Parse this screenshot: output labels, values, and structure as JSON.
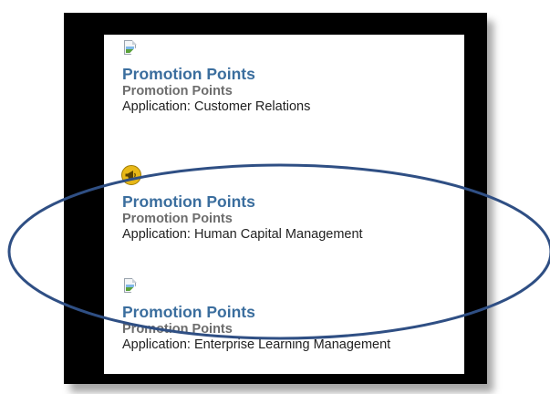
{
  "results": [
    {
      "icon": "broken-image-icon",
      "title": "Promotion Points",
      "subtitle": "Promotion Points",
      "application": "Application: Customer Relations"
    },
    {
      "icon": "megaphone-icon",
      "title": "Promotion Points",
      "subtitle": "Promotion Points",
      "application": "Application: Human Capital Management"
    },
    {
      "icon": "broken-image-icon",
      "title": "Promotion Points",
      "subtitle": "Promotion Points",
      "application": "Application: Enterprise Learning Management"
    }
  ],
  "colors": {
    "title": "#3b6e9e",
    "subtitle": "#6d6d6d",
    "application": "#222222",
    "frame": "#000000",
    "highlight_ellipse": "#2f4f84",
    "megaphone_badge": "#e8b817"
  }
}
